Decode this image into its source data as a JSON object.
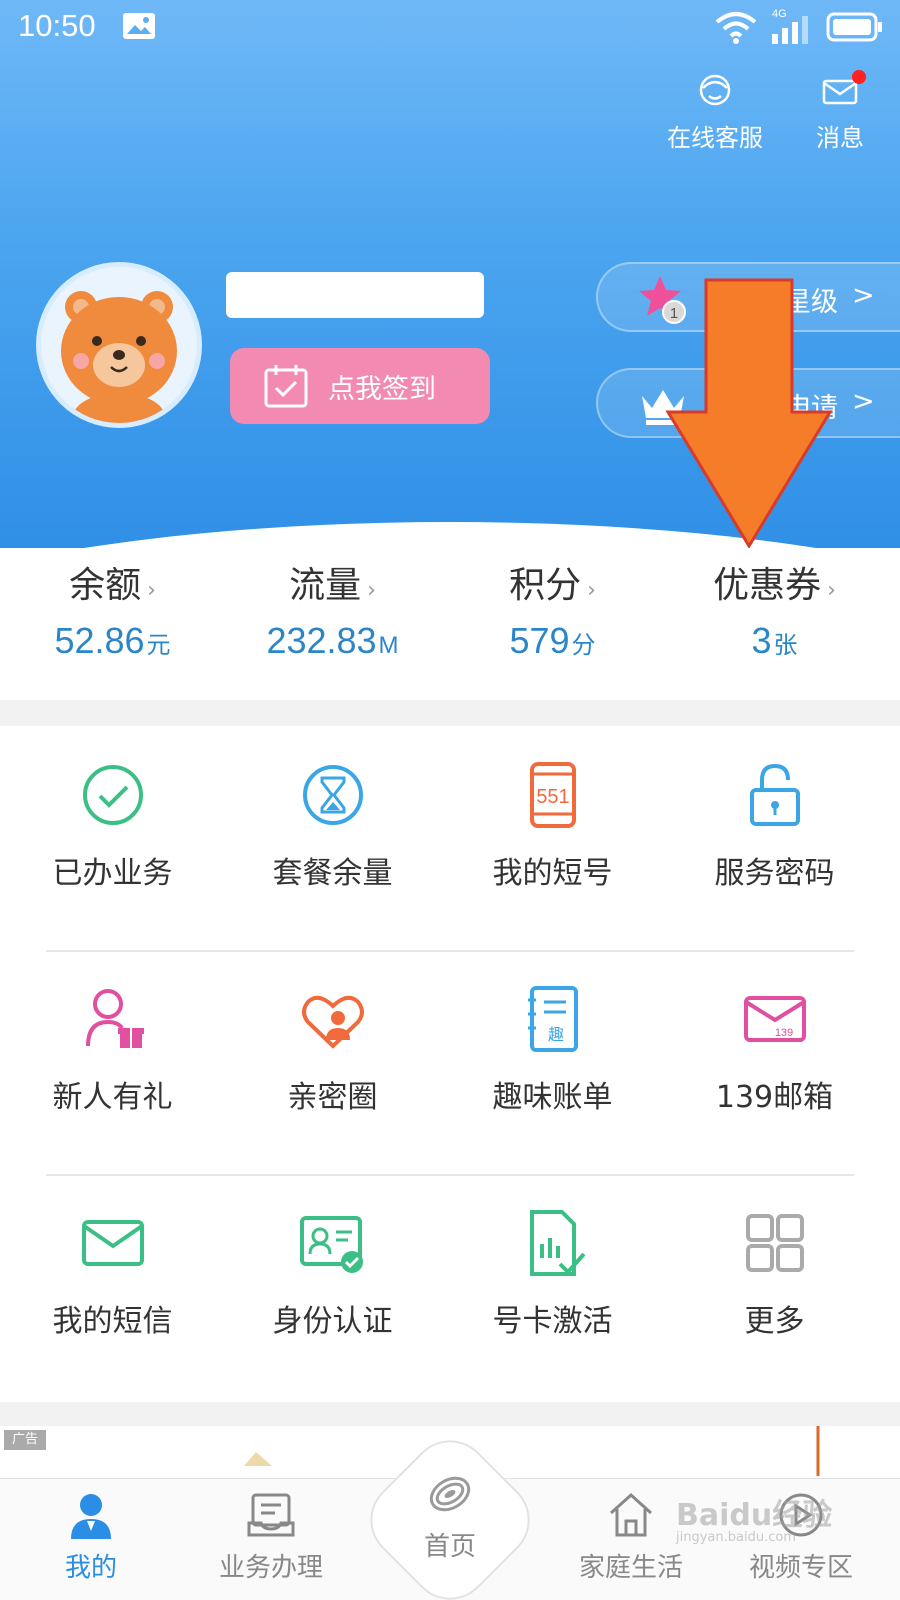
{
  "status_bar": {
    "time": "10:50",
    "network": "4G"
  },
  "top_actions": {
    "service_label": "在线客服",
    "message_label": "消息"
  },
  "profile": {
    "signin_label": "点我签到"
  },
  "pills": {
    "star_badge": "1",
    "star_text": "星级",
    "star_arrow": ">",
    "crown_text": "申请",
    "crown_arrow": ">"
  },
  "stats": [
    {
      "label": "余额",
      "value": "52.86",
      "unit": "元"
    },
    {
      "label": "流量",
      "value": "232.83",
      "unit": "M"
    },
    {
      "label": "积分",
      "value": "579",
      "unit": "分"
    },
    {
      "label": "优惠券",
      "value": "3",
      "unit": "张"
    }
  ],
  "stat_chevron": "›",
  "grid": [
    {
      "label": "已办业务",
      "icon": "check-circle-icon"
    },
    {
      "label": "套餐余量",
      "icon": "hourglass-icon"
    },
    {
      "label": "我的短号",
      "icon": "phone-551-icon",
      "icon_text": "551"
    },
    {
      "label": "服务密码",
      "icon": "lock-icon"
    },
    {
      "label": "新人有礼",
      "icon": "user-gift-icon"
    },
    {
      "label": "亲密圈",
      "icon": "heart-group-icon"
    },
    {
      "label": "趣味账单",
      "icon": "bill-notebook-icon",
      "icon_text": "趣"
    },
    {
      "label": "139邮箱",
      "icon": "mail-139-icon",
      "icon_text": "139"
    },
    {
      "label": "我的短信",
      "icon": "envelope-icon"
    },
    {
      "label": "身份认证",
      "icon": "id-card-icon"
    },
    {
      "label": "号卡激活",
      "icon": "sim-activate-icon"
    },
    {
      "label": "更多",
      "icon": "grid-more-icon"
    }
  ],
  "ad": {
    "tag": "广告"
  },
  "bottom_nav": [
    {
      "label": "我的",
      "icon": "user-icon",
      "active": true
    },
    {
      "label": "业务办理",
      "icon": "inbox-icon",
      "active": false
    },
    {
      "label": "首页",
      "icon": "china-mobile-logo-icon",
      "active": false
    },
    {
      "label": "家庭生活",
      "icon": "house-icon",
      "active": false
    },
    {
      "label": "视频专区",
      "icon": "play-circle-icon",
      "active": false
    }
  ],
  "watermark": {
    "brand": "Baidu经验",
    "url": "jingyan.baidu.com"
  },
  "colors": {
    "header_top": "#6fb8f7",
    "header_bottom": "#2f8fe6",
    "accent_blue": "#2b86c8",
    "signin_pink": "#f28ab2",
    "annotation_arrow": "#f57c28"
  }
}
